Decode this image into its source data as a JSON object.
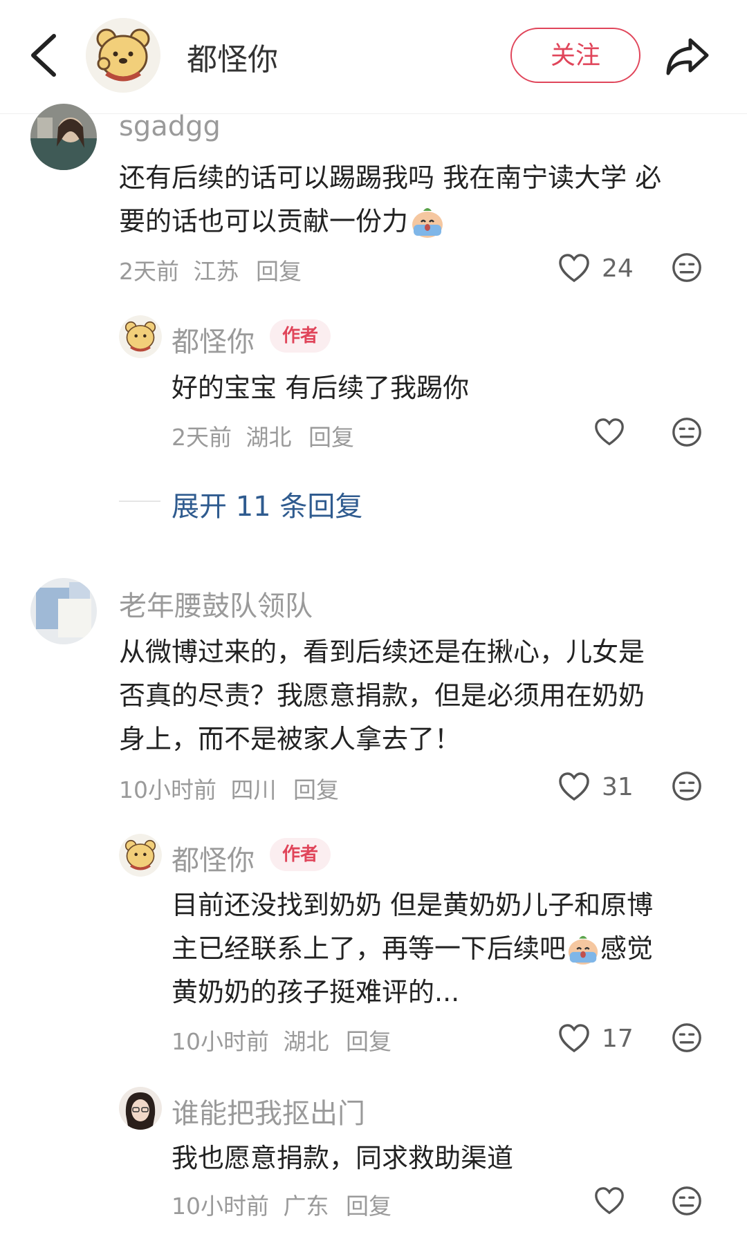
{
  "header": {
    "title": "都怪你",
    "follow_label": "关注"
  },
  "comments": [
    {
      "user": "sgadgg",
      "text_line1": "还有后续的话可以踢踢我吗 我在南宁读大学 必",
      "text_line2": "要的话也可以贡献一份力",
      "time": "2天前",
      "location": "江苏",
      "reply": "回复",
      "likes": "24",
      "sub_reply": {
        "user": "都怪你",
        "badge": "作者",
        "text": "好的宝宝 有后续了我踢你",
        "time": "2天前",
        "location": "湖北",
        "reply": "回复"
      },
      "expand": "展开 11 条回复"
    },
    {
      "user": "老年腰鼓队领队",
      "text_line1": "从微博过来的，看到后续还是在揪心，儿女是",
      "text_line2": "否真的尽责？我愿意捐款，但是必须用在奶奶",
      "text_line3": "身上，而不是被家人拿去了！",
      "time": "10小时前",
      "location": "四川",
      "reply": "回复",
      "likes": "31",
      "sub_reply": {
        "user": "都怪你",
        "badge": "作者",
        "text_line1": "目前还没找到奶奶 但是黄奶奶儿子和原博",
        "text_line2a": "主已经联系上了，再等一下后续吧",
        "text_line2b": "感觉",
        "text_line3": "黄奶奶的孩子挺难评的...",
        "time": "10小时前",
        "location": "湖北",
        "reply": "回复",
        "likes": "17"
      },
      "sub_reply2": {
        "user": "谁能把我抠出门",
        "text": "我也愿意捐款，同求救助渠道",
        "time": "10小时前",
        "location": "广东",
        "reply": "回复"
      }
    }
  ],
  "colors": {
    "accent": "#e0455a",
    "link": "#2f5b8f",
    "muted": "#9a9a9a"
  }
}
